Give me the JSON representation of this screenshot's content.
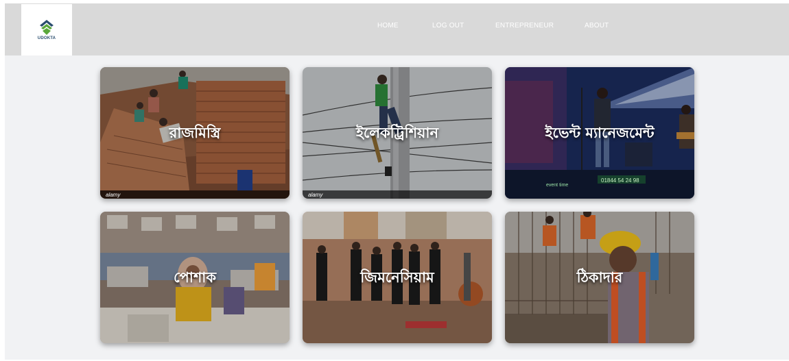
{
  "brand": {
    "logo_text": "UDOKTA",
    "colors": {
      "green": "#5aa83a",
      "navy": "#2a4d6e"
    }
  },
  "nav": {
    "items": [
      {
        "label": "HOME"
      },
      {
        "label": "LOG OUT"
      },
      {
        "label": "ENTREPRENEUR"
      },
      {
        "label": "ABOUT"
      }
    ]
  },
  "categories": [
    {
      "title": "রাজমিস্ত্রি",
      "icon": "mason-photo",
      "stock_label": "alamy"
    },
    {
      "title": "ইলেকট্রিশিয়ান",
      "icon": "electrician-photo",
      "stock_label": "alamy"
    },
    {
      "title": "ইভেন্ট ম্যানেজমেন্ট",
      "icon": "event-photo",
      "event_tag": "event time",
      "event_phone": "01844 54 24 98"
    },
    {
      "title": "পোশাক",
      "icon": "garments-photo"
    },
    {
      "title": "জিমনেসিয়াম",
      "icon": "gym-photo"
    },
    {
      "title": "ঠিকাদার",
      "icon": "contractor-photo"
    }
  ]
}
